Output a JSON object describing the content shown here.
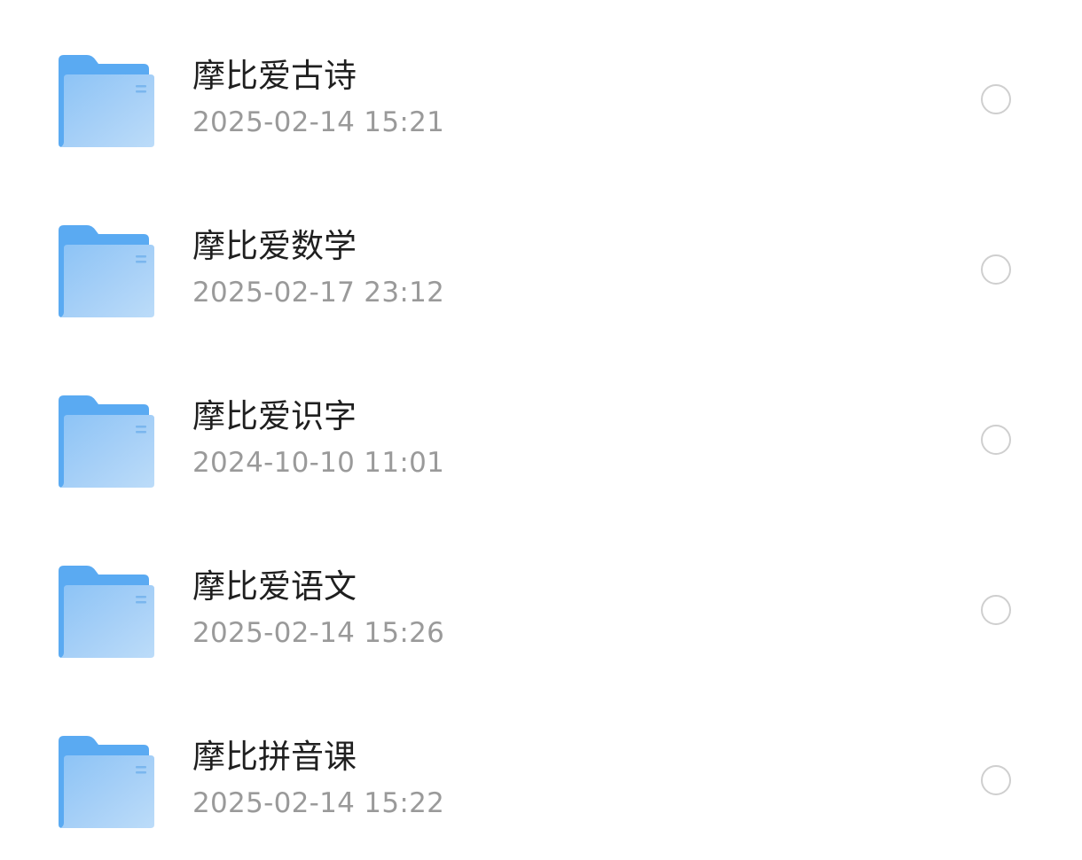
{
  "colors": {
    "title_text": "#1f1f1f",
    "date_text": "#9a9a9a",
    "radio_border": "#cfcfcf",
    "folder_back": "#5aaaf2",
    "folder_front": "#a5cff5"
  },
  "icons": {
    "folder": "folder-icon",
    "select": "radio-circle-icon"
  },
  "folders": [
    {
      "name": "摩比爱古诗",
      "modified": "2025-02-14 15:21",
      "selected": false
    },
    {
      "name": "摩比爱数学",
      "modified": "2025-02-17 23:12",
      "selected": false
    },
    {
      "name": "摩比爱识字",
      "modified": "2024-10-10 11:01",
      "selected": false
    },
    {
      "name": "摩比爱语文",
      "modified": "2025-02-14 15:26",
      "selected": false
    },
    {
      "name": "摩比拼音课",
      "modified": "2025-02-14 15:22",
      "selected": false
    }
  ]
}
